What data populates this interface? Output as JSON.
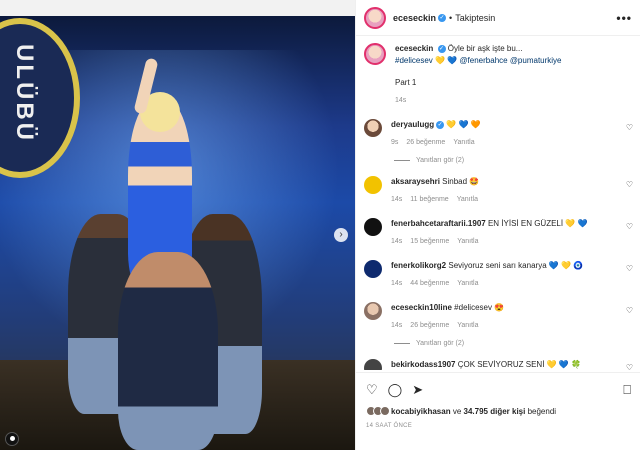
{
  "post": {
    "username": "eceseckin",
    "follow_label": "Takiptesin",
    "more_label": "•••",
    "caption": {
      "username": "eceseckin",
      "text": "Öyle bir aşk işte bu...",
      "hashtag": "#delicesev",
      "emojis": "💛 💙",
      "mentions": "@fenerbahce @pumaturkiye",
      "extra": "Part 1",
      "time": "14s"
    },
    "media": {
      "badge_text": "ULÜBÜ",
      "next_icon": "chevron-right-icon"
    }
  },
  "comments": [
    {
      "username": "deryaulugg",
      "verified": true,
      "text": "💛 💙 🧡",
      "time": "9s",
      "likes": "26 beğenme",
      "reply": "Yanıtla",
      "view_replies": "Yanıtları gör (2)",
      "avatar": "av-deryaulugg"
    },
    {
      "username": "aksaraysehri",
      "verified": false,
      "text": "Sinbad 🤩",
      "time": "14s",
      "likes": "11 beğenme",
      "reply": "Yanıtla",
      "avatar": "av-aksaray"
    },
    {
      "username": "fenerbahcetaraftarii.1907",
      "verified": false,
      "text": "EN İYİSİ EN GÜZELİ 💛 💙",
      "time": "14s",
      "likes": "15 beğenme",
      "reply": "Yanıtla",
      "avatar": "av-fbtaraftar"
    },
    {
      "username": "fenerkolikorg2",
      "verified": false,
      "text": "Seviyoruz seni sarı kanarya 💙 💛 🧿",
      "time": "14s",
      "likes": "44 beğenme",
      "reply": "Yanıtla",
      "avatar": "av-fbkolik"
    },
    {
      "username": "eceseckin10line",
      "verified": false,
      "text": "#delicesev 😍",
      "time": "14s",
      "likes": "26 beğenme",
      "reply": "Yanıtla",
      "view_replies": "Yanıtları gör (2)",
      "avatar": "av-ece10"
    },
    {
      "username": "bekirkodass1907",
      "verified": false,
      "text": "ÇOK SEVİYORUZ SENİ 💛 💙 🍀",
      "avatar": "av-bekir"
    }
  ],
  "actions": {
    "like_icon": "heart-icon",
    "comment_icon": "comment-icon",
    "share_icon": "share-icon",
    "save_icon": "bookmark-icon"
  },
  "likes": {
    "first_user": "kocabiyikhasan",
    "and": "ve",
    "others": "34.795 diğer kişi",
    "liked": "beğendi"
  },
  "timestamp": "14 SAAT ÖNCE",
  "heart_glyph": "♡"
}
